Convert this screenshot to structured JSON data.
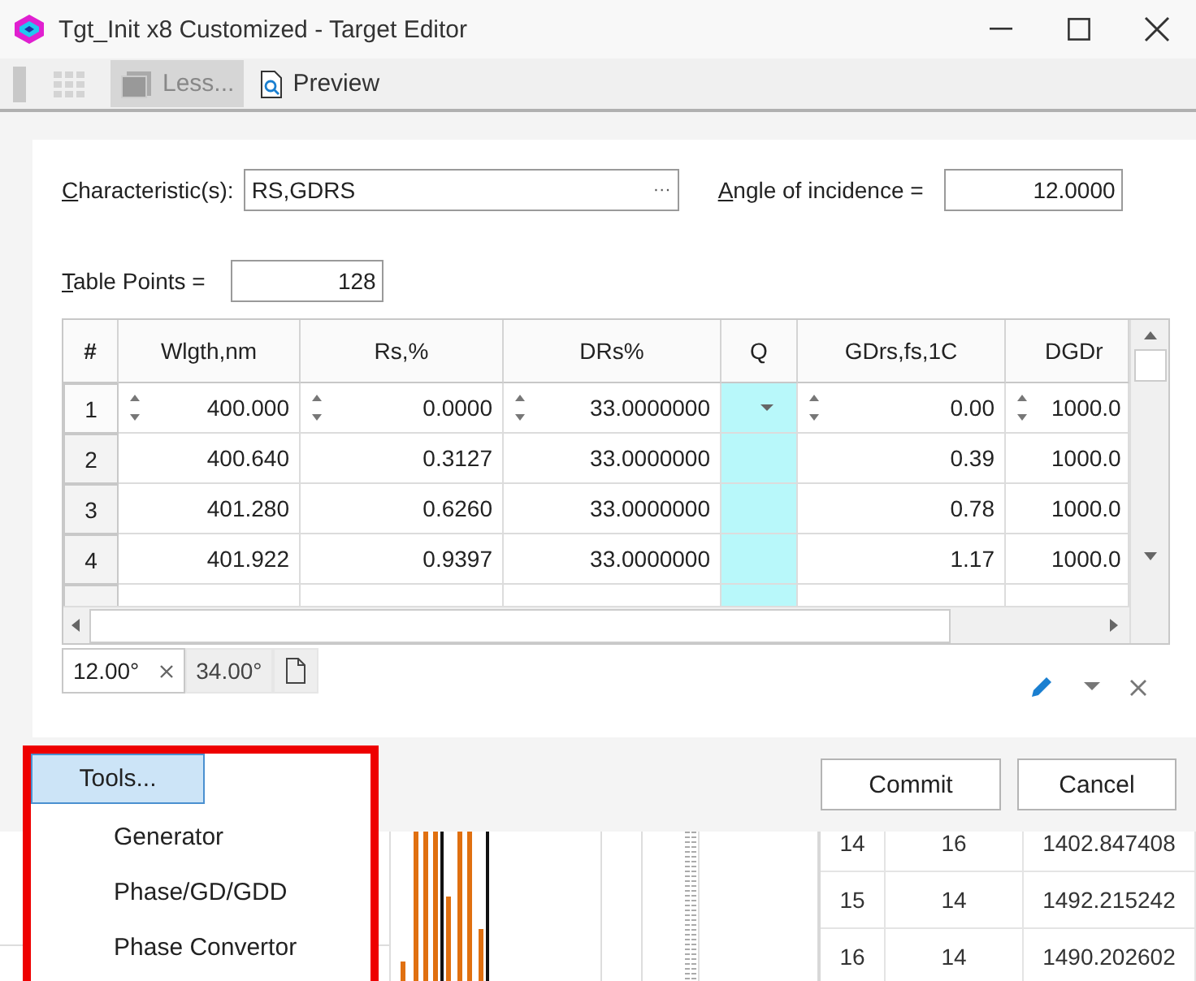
{
  "window": {
    "title": "Tgt_Init x8 Customized - Target Editor"
  },
  "toolbar": {
    "less": {
      "label": "Less...",
      "pressed": true
    },
    "preview": {
      "label": "Preview",
      "pressed": false
    }
  },
  "form": {
    "characteristics": {
      "label": "Characteristic(s):",
      "value": "RS,GDRS",
      "picker": "···"
    },
    "angle": {
      "label": "Angle of incidence =",
      "value": "12.0000"
    },
    "table_points": {
      "label": "Table Points =",
      "value": "128"
    }
  },
  "grid": {
    "columns": [
      "#",
      "Wlgth,nm",
      "Rs,%",
      "DRs%",
      "Q",
      "GDrs,fs,1C",
      "DGDr"
    ],
    "rows": [
      {
        "editing": true,
        "cells": [
          "1",
          "400.000",
          "0.0000",
          "33.0000000",
          "",
          "0.00",
          "1000.0"
        ]
      },
      {
        "editing": false,
        "cells": [
          "2",
          "400.640",
          "0.3127",
          "33.0000000",
          "",
          "0.39",
          "1000.0"
        ]
      },
      {
        "editing": false,
        "cells": [
          "3",
          "401.280",
          "0.6260",
          "33.0000000",
          "",
          "0.78",
          "1000.0"
        ]
      },
      {
        "editing": false,
        "cells": [
          "4",
          "401.922",
          "0.9397",
          "33.0000000",
          "",
          "1.17",
          "1000.0"
        ]
      }
    ]
  },
  "angle_tabs": [
    {
      "label": "12.00°",
      "selected": true,
      "closable": true
    },
    {
      "label": "34.00°",
      "selected": false,
      "closable": false
    }
  ],
  "buttons": [
    "Commit",
    "Cancel"
  ],
  "tools_menu": {
    "button": "Tools...",
    "items": [
      "Generator",
      "Phase/GD/GDD",
      "Phase Convertor"
    ]
  },
  "background_table": {
    "rows": [
      [
        "14",
        "16",
        "1402.847408"
      ],
      [
        "15",
        "14",
        "1492.215242"
      ],
      [
        "16",
        "14",
        "1490.202602"
      ]
    ]
  }
}
